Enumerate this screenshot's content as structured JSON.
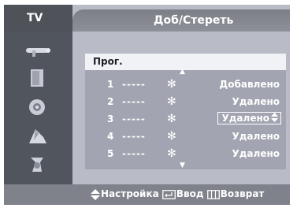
{
  "header": {
    "tab_label": "TV",
    "title": "Доб/Стереть"
  },
  "sidebar": {
    "icons": [
      "antenna-icon",
      "tv-set-icon",
      "speaker-icon",
      "channel-setup-icon",
      "setup-icon"
    ]
  },
  "list": {
    "column_header": "Прог.",
    "up_arrow": "▲",
    "down_arrow": "▼",
    "rows": [
      {
        "number": "1",
        "name": "-----",
        "mark": "✻",
        "status": "Добавлено",
        "selected": false
      },
      {
        "number": "2",
        "name": "-----",
        "mark": "✻",
        "status": "Удалено",
        "selected": false
      },
      {
        "number": "3",
        "name": "-----",
        "mark": "✻",
        "status": "Удалено",
        "selected": true
      },
      {
        "number": "4",
        "name": "-----",
        "mark": "✻",
        "status": "Удалено",
        "selected": false
      },
      {
        "number": "5",
        "name": "-----",
        "mark": "✻",
        "status": "Удалено",
        "selected": false
      }
    ]
  },
  "footer": {
    "adjust_label": "Настройка",
    "enter_label": "Ввод",
    "return_label": "Возврат"
  }
}
